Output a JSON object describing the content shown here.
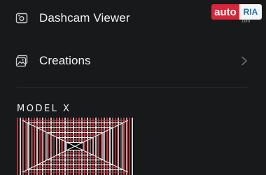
{
  "menu": {
    "items": [
      {
        "label": "Dashcam Viewer",
        "icon": "camera-screen-icon"
      },
      {
        "label": "Creations",
        "icon": "gallery-icon",
        "has_chevron": true
      }
    ]
  },
  "vehicle": {
    "model_name": "Model X"
  },
  "watermark": {
    "brand_left": "auto",
    "brand_right": "RIA",
    "brand_sub": ".com"
  },
  "colors": {
    "background": "#18191b",
    "divider": "#2d2e31",
    "accent_red": "#d6273a"
  }
}
